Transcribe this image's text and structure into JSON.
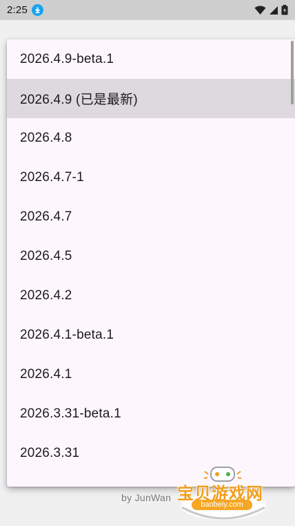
{
  "status_bar": {
    "time": "2:25",
    "icons": [
      "download-icon",
      "wifi-icon",
      "signal-icon",
      "battery-icon"
    ]
  },
  "footer": {
    "text": "by JunWan"
  },
  "version_menu": {
    "items": [
      {
        "label": "2026.4.9-beta.1",
        "selected": false
      },
      {
        "label": "2026.4.9 (已是最新)",
        "selected": true
      },
      {
        "label": "2026.4.8",
        "selected": false
      },
      {
        "label": "2026.4.7-1",
        "selected": false
      },
      {
        "label": "2026.4.7",
        "selected": false
      },
      {
        "label": "2026.4.5",
        "selected": false
      },
      {
        "label": "2026.4.2",
        "selected": false
      },
      {
        "label": "2026.4.1-beta.1",
        "selected": false
      },
      {
        "label": "2026.4.1",
        "selected": false
      },
      {
        "label": "2026.3.31-beta.1",
        "selected": false
      },
      {
        "label": "2026.3.31",
        "selected": false
      }
    ]
  },
  "watermark": {
    "title": "宝贝游戏网",
    "url": "baobeiy.com"
  },
  "colors": {
    "status_bar_bg": "#cfcfcf",
    "menu_bg": "#fdf7fd",
    "selected_bg": "#ddd9de",
    "download_badge": "#1aa3ef",
    "watermark_orange": "#f29d1a"
  }
}
